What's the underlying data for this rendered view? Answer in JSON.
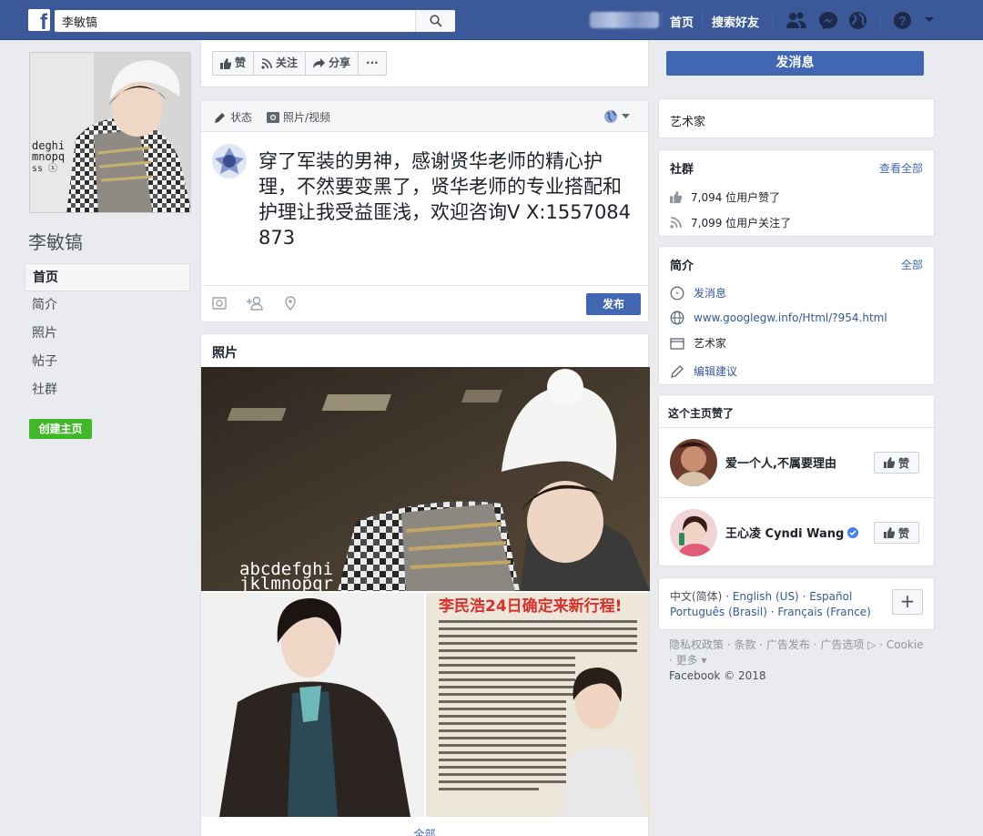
{
  "topbar": {
    "search_value": "李敏镐",
    "nav_home": "首页",
    "nav_find_friends": "搜索好友",
    "icons": [
      "friends-icon",
      "messenger-icon",
      "notifications-globe-icon",
      "help-icon",
      "account-menu-icon"
    ],
    "brand_color": "#3b5998"
  },
  "left": {
    "page_name": "李敏镐",
    "nav": [
      {
        "label": "首页",
        "active": true
      },
      {
        "label": "简介",
        "active": false
      },
      {
        "label": "照片",
        "active": false
      },
      {
        "label": "帖子",
        "active": false
      },
      {
        "label": "社群",
        "active": false
      }
    ],
    "create_page_label": "创建主页"
  },
  "actions": {
    "like_label": "赞",
    "follow_label": "关注",
    "share_label": "分享",
    "more_label": "···"
  },
  "composer": {
    "tab_status": "状态",
    "tab_photo_video": "照片/视频",
    "text": "穿了军装的男神，感谢贤华老师的精心护理，不然要变黑了，贤华老师的专业搭配和护理让我受益匪浅，欢迎咨询V X:1557084873",
    "publish_label": "发布"
  },
  "photos": {
    "title": "照片",
    "main_overlay": [
      "abcdefghi",
      "jklmnopqr"
    ],
    "right_headline": "李民浩24日确定来新行程!",
    "see_all": "全部"
  },
  "right": {
    "message_label": "发消息",
    "category": "艺术家",
    "community": {
      "title": "社群",
      "see_all": "查看全部",
      "likes_text": "7,094 位用户赞了",
      "follows_text": "7,099 位用户关注了"
    },
    "about": {
      "title": "简介",
      "all": "全部",
      "message": "发消息",
      "website": "www.googlegw.info/Html/?954.html",
      "category": "艺术家",
      "suggest_edit": "编辑建议"
    },
    "page_likes": {
      "title": "这个主页赞了",
      "items": [
        {
          "name": "爱一个人,不属要理由",
          "like_label": "赞",
          "verified": false
        },
        {
          "name": "王心凌 Cyndi Wang",
          "like_label": "赞",
          "verified": true
        }
      ]
    },
    "languages": {
      "current": "中文(简体)",
      "others": [
        "English (US)",
        "Español",
        "Português (Brasil)",
        "Français (France)"
      ],
      "add_label": "+"
    },
    "footer": {
      "links": "隐私权政策 · 条款 · 广告发布 · 广告选项 ▷ · Cookie · 更多 ▾",
      "copyright": "Facebook © 2018"
    }
  }
}
